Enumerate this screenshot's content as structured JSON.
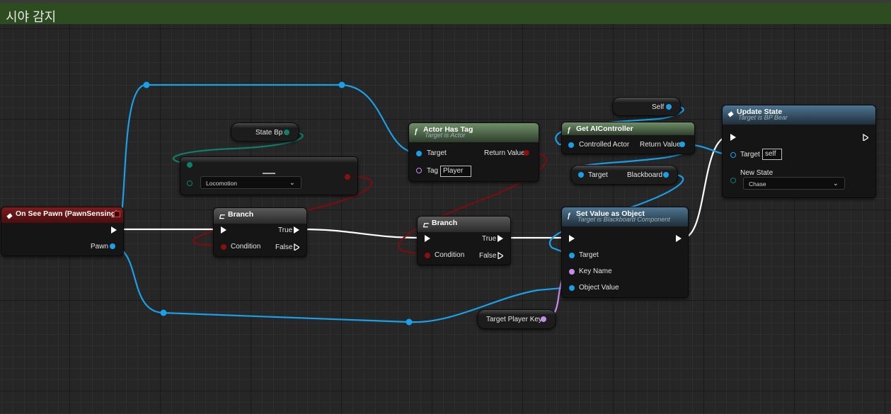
{
  "comment": {
    "title": "시야 감지"
  },
  "colors": {
    "exec": "#ffffff",
    "object": "#1aa0e8",
    "bool": "#8a0f0f",
    "name": "#c48ee8",
    "enum": "#0f7e6a",
    "event_header": "#6d1414",
    "function_header": "#5f7a5a",
    "target_header": "#3b5d76",
    "comment_header": "#2d4c1f"
  },
  "nodes": {
    "event": {
      "title": "On See Pawn (PawnSensing)",
      "pawn_label": "Pawn",
      "icon": "event-diamond-icon"
    },
    "state_bp": {
      "label": "State Bp"
    },
    "enum_switch": {
      "selected": "Locomotion"
    },
    "branch1": {
      "title": "Branch",
      "condition": "Condition",
      "true_label": "True",
      "false_label": "False"
    },
    "branch2": {
      "title": "Branch",
      "condition": "Condition",
      "true_label": "True",
      "false_label": "False"
    },
    "actor_has_tag": {
      "title": "Actor Has Tag",
      "subtitle": "Target is Actor",
      "target": "Target",
      "return": "Return Value",
      "tag_label": "Tag",
      "tag_value": "Player"
    },
    "self": {
      "label": "Self"
    },
    "get_ai_controller": {
      "title": "Get AIController",
      "controlled_actor": "Controlled Actor",
      "return": "Return Value"
    },
    "blackboard": {
      "target": "Target",
      "blackboard": "Blackboard"
    },
    "set_value": {
      "title": "Set Value as Object",
      "subtitle": "Target is Blackboard Component",
      "target": "Target",
      "key_name": "Key Name",
      "object_value": "Object Value"
    },
    "target_player_key": {
      "label": "Target Player Key"
    },
    "update_state": {
      "title": "Update State",
      "subtitle": "Target is BP Bear",
      "target": "Target",
      "target_value": "self",
      "new_state": "New State",
      "new_state_value": "Chase"
    }
  }
}
